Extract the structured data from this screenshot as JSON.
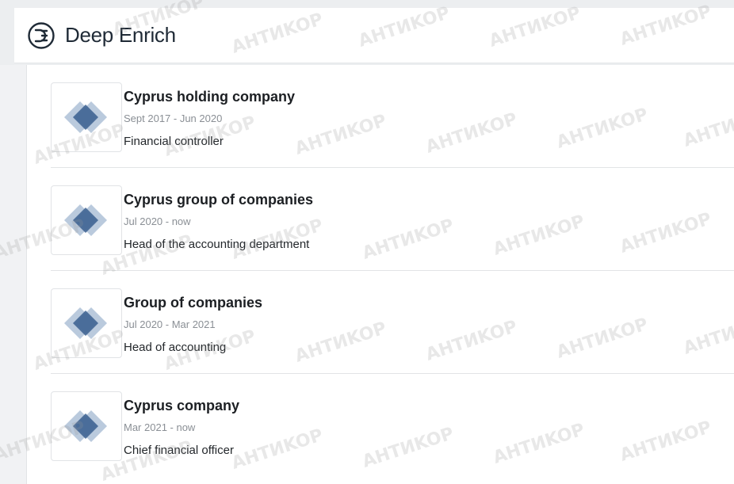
{
  "app": {
    "brand": "Deep Enrich",
    "logo_icon": "deep-enrich-logo-icon"
  },
  "watermark_text": "AHTИKOP",
  "experiences": [
    {
      "company": "Cyprus holding company",
      "dates": "Sept 2017 - Jun 2020",
      "role": "Financial controller",
      "logo_icon": "company-diamond-icon"
    },
    {
      "company": "Cyprus group of companies",
      "dates": "Jul 2020 - now",
      "role": "Head of the accounting department",
      "logo_icon": "company-diamond-icon"
    },
    {
      "company": "Group of companies",
      "dates": "Jul 2020 - Mar 2021",
      "role": "Head of accounting",
      "logo_icon": "company-diamond-icon"
    },
    {
      "company": "Cyprus company",
      "dates": "Mar 2021 - now",
      "role": "Chief financial officer",
      "logo_icon": "company-diamond-icon"
    }
  ],
  "colors": {
    "accent": "#2e4d7b",
    "diamond_dark": "#3a5f8f",
    "diamond_light": "#9db4cf"
  }
}
